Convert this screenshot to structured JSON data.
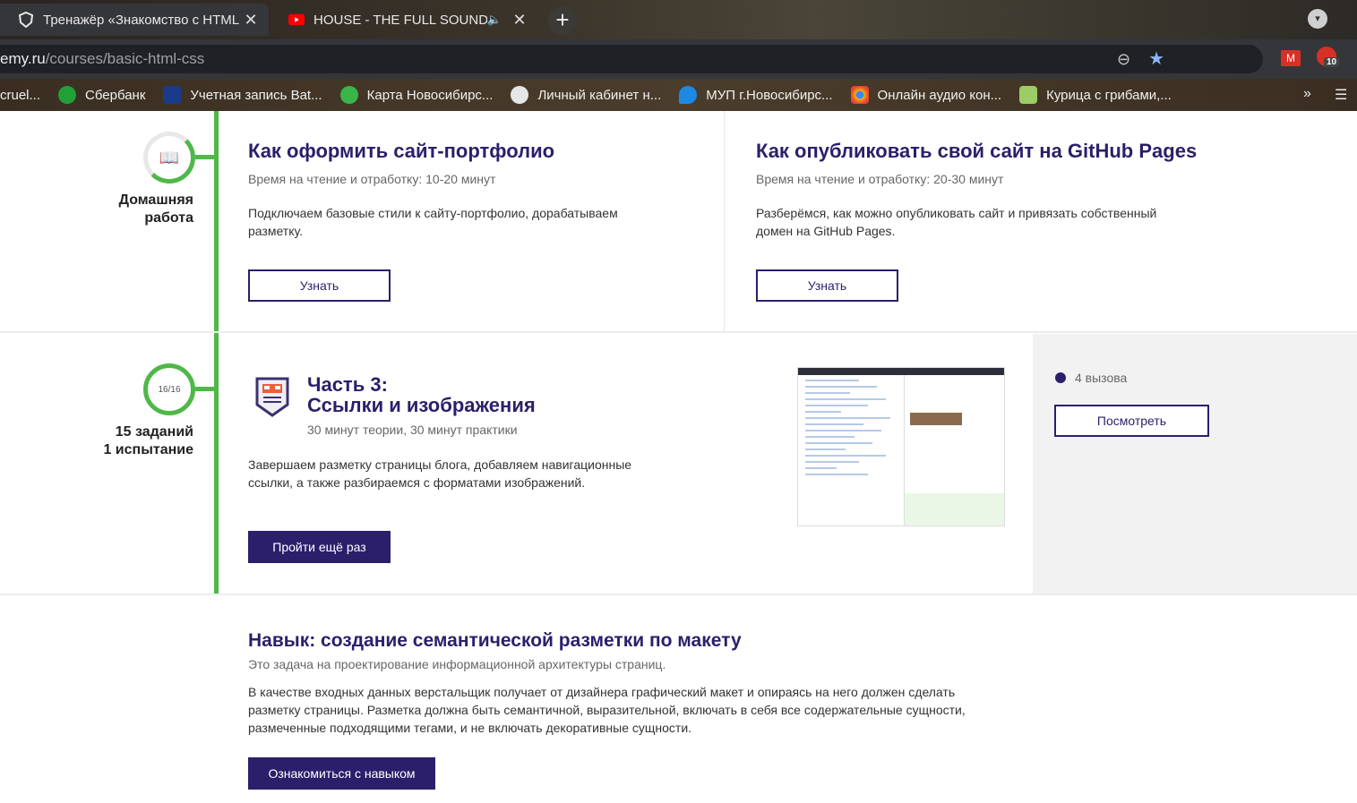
{
  "browser": {
    "tabs": [
      {
        "title": "Тренажёр «Знакомство с HTML",
        "active": true
      },
      {
        "title": "HOUSE - THE FULL SOUNDTR",
        "active": false
      }
    ],
    "url_host": "emy.ru",
    "url_path": "/courses/basic-html-css",
    "ext_badge": "10",
    "bookmarks": [
      {
        "label": "cruel...",
        "color": "#6b5a3a"
      },
      {
        "label": "Сбербанк",
        "color": "#21a038"
      },
      {
        "label": "Учетная запись Bat...",
        "color": "#1a3a8a"
      },
      {
        "label": "Карта Новосибирс...",
        "color": "#3ab54a"
      },
      {
        "label": "Личный кабинет н...",
        "color": "#e6e6e6"
      },
      {
        "label": "МУП г.Новосибирс...",
        "color": "#1e88e5"
      },
      {
        "label": "Онлайн аудио кон...",
        "color": "#f4b400"
      },
      {
        "label": "Курица с грибами,...",
        "color": "#9ccc65"
      }
    ],
    "bookmarks_more": "»"
  },
  "colors": {
    "accent": "#2b1f6b",
    "progress": "#4fb848"
  },
  "homework": {
    "label_line1": "Домашняя",
    "label_line2": "работа",
    "cards": [
      {
        "title": "Как оформить сайт-портфолио",
        "time": "Время на чтение и отработку: 10-20 минут",
        "desc_line1": "Подключаем базовые стили к сайту-портфолио, дорабатываем",
        "desc_line2": "разметку.",
        "button": "Узнать"
      },
      {
        "title": "Как опубликовать свой сайт на GitHub Pages",
        "time": "Время на чтение и отработку: 20-30 минут",
        "desc_line1": "Разберёмся, как можно опубликовать сайт и привязать собственный",
        "desc_line2": "домен на GitHub Pages.",
        "button": "Узнать"
      }
    ]
  },
  "part3": {
    "counter": "16/16",
    "tasks": "15 заданий",
    "trials": "1 испытание",
    "title_line1": "Часть 3:",
    "title_line2": "Ссылки и изображения",
    "duration": "30 минут теории, 30 минут практики",
    "desc_line1": "Завершаем разметку страницы блога, добавляем навигационные",
    "desc_line2": "ссылки, а также разбираемся с форматами изображений.",
    "retry_button": "Пройти ещё раз",
    "challenges": "4 вызова",
    "view_button": "Посмотреть"
  },
  "skill": {
    "title": "Навык: создание семантической разметки по макету",
    "subtitle": "Это задача на проектирование информационной архитектуры страниц.",
    "desc_line1": "В качестве входных данных верстальщик получает от дизайнера графический макет и опираясь на него должен сделать",
    "desc_line2": "разметку страницы. Разметка должна быть семантичной, выразительной, включать в себя все содержательные сущности,",
    "desc_line3": "размеченные подходящими тегами, и не включать декоративные сущности.",
    "button": "Ознакомиться с навыком"
  }
}
